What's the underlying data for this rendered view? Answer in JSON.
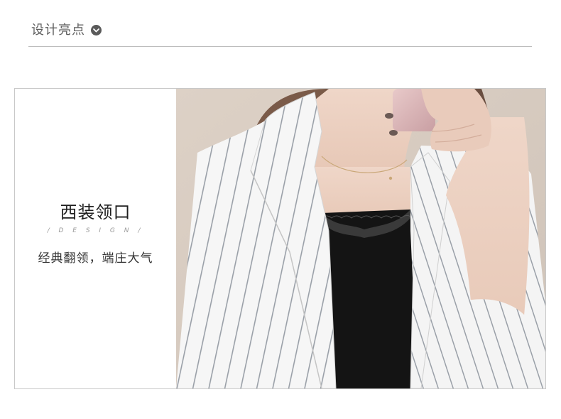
{
  "header": {
    "title": "设计亮点",
    "icon": "chevron-down-icon"
  },
  "feature": {
    "title": "西装领口",
    "subtitle": "/ D E S I G N /",
    "description": "经典翻领，端庄大气"
  },
  "photo": {
    "subject": "woman-in-white-pinstripe-blazer-taking-mirror-selfie"
  },
  "colors": {
    "background": "#ffffff",
    "divider": "#bdbdbd",
    "card_border": "#c8c8c8",
    "title_text": "#1f1f1f",
    "header_text": "#5e5e5e"
  }
}
